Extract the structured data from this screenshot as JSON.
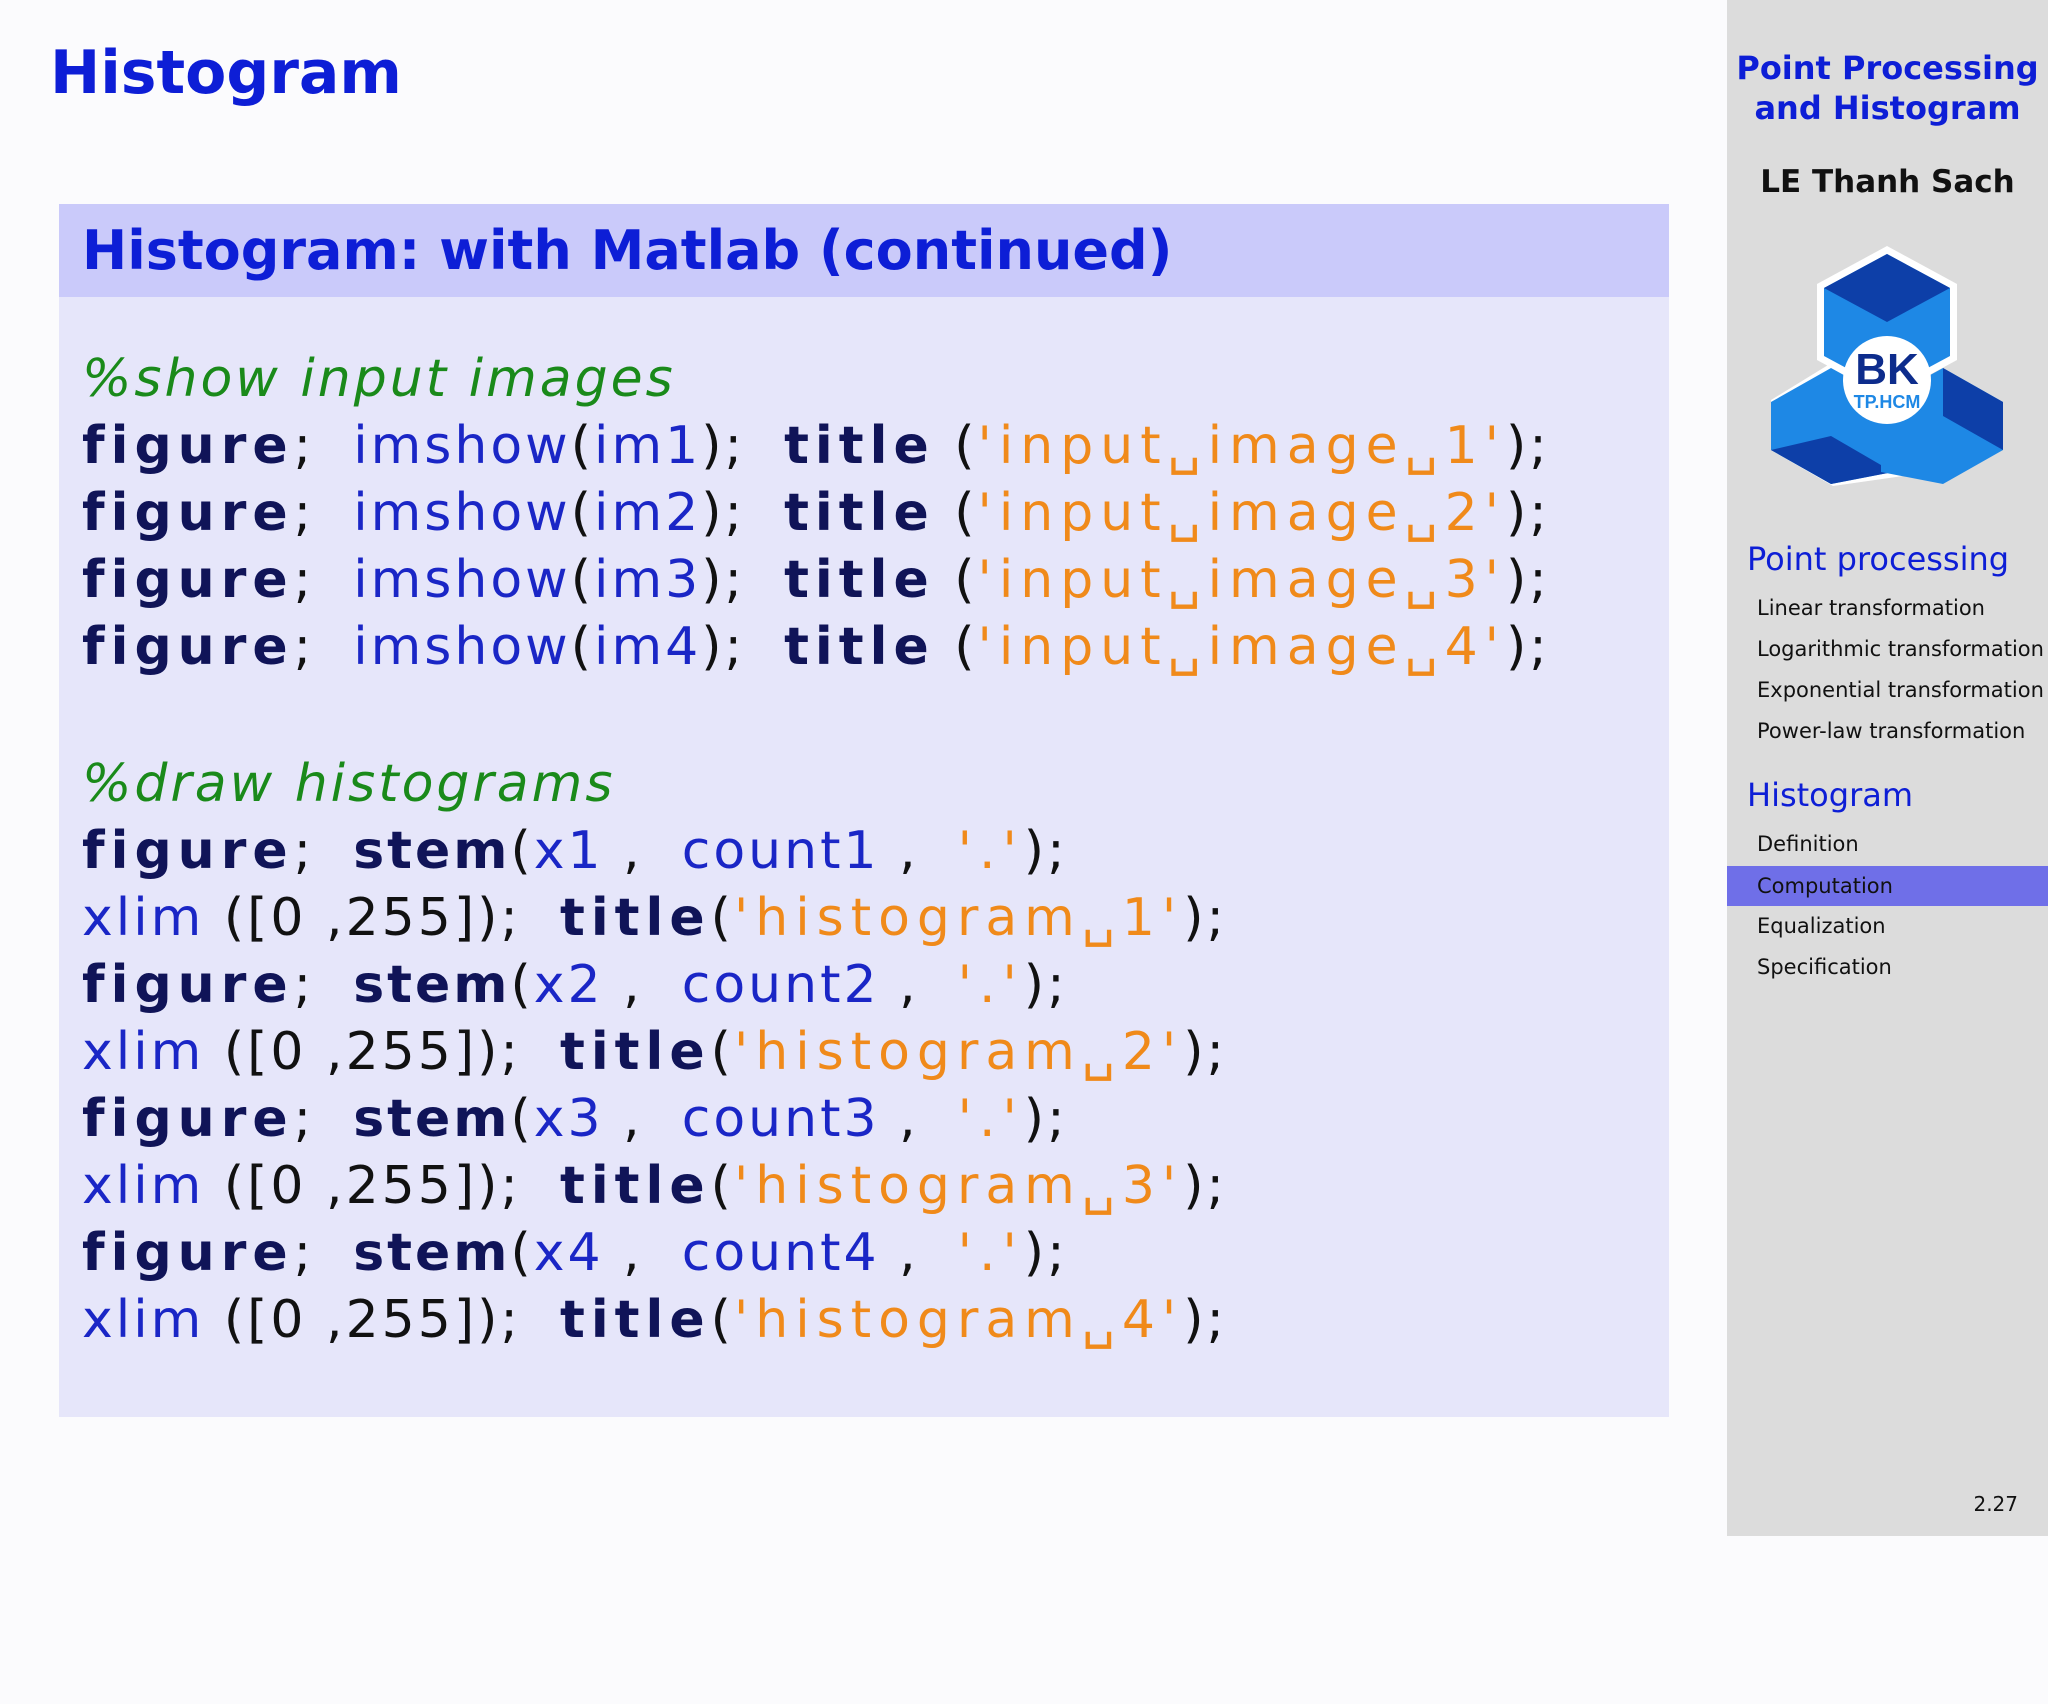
{
  "slide": {
    "title": "Histogram",
    "block_title": "Histogram: with Matlab (continued)",
    "page_number": "2.27"
  },
  "code": {
    "comment1": "%show input images",
    "comment2": "%draw histograms",
    "kw_figure": "figure",
    "kw_title": "title",
    "kw_stem": "stem",
    "fn_imshow": "imshow",
    "fn_xlim": "xlim",
    "semi": ";",
    "lp": "(",
    "rp": ")",
    "comma": ",",
    "imshow_lines": [
      {
        "arg": "im1",
        "str": "'input␣image␣1'"
      },
      {
        "arg": "im2",
        "str": "'input␣image␣2'"
      },
      {
        "arg": "im3",
        "str": "'input␣image␣3'"
      },
      {
        "arg": "im4",
        "str": "'input␣image␣4'"
      }
    ],
    "hist_lines": [
      {
        "x": "x1",
        "count": "count1",
        "dot": "'.'",
        "range": "([0 ,255])",
        "str": "'histogram␣1'"
      },
      {
        "x": "x2",
        "count": "count2",
        "dot": "'.'",
        "range": "([0 ,255])",
        "str": "'histogram␣2'"
      },
      {
        "x": "x3",
        "count": "count3",
        "dot": "'.'",
        "range": "([0 ,255])",
        "str": "'histogram␣3'"
      },
      {
        "x": "x4",
        "count": "count4",
        "dot": "'.'",
        "range": "([0 ,255])",
        "str": "'histogram␣4'"
      }
    ]
  },
  "sidebar": {
    "title_line1": "Point Processing",
    "title_line2": "and Histogram",
    "author": "LE Thanh Sach",
    "logo_text": "BK",
    "logo_subtext": "TP.HCM",
    "sections": [
      {
        "label": "Point processing",
        "items": [
          "Linear transformation",
          "Logarithmic transformation",
          "Exponential transformation",
          "Power-law transformation"
        ]
      },
      {
        "label": "Histogram",
        "items": [
          "Definition",
          "Computation",
          "Equalization",
          "Specification"
        ]
      }
    ],
    "active_item": "Computation"
  },
  "colors": {
    "title": "#0d1ed6",
    "block_header": "#cacafa",
    "block_body": "#e6e6fa",
    "comment": "#1a8a1a",
    "keyword": "#101458",
    "function": "#1a26c6",
    "string": "#f08a1a",
    "sidebar_bg": "#dcdcdc",
    "active_bg": "#6f6fe8"
  }
}
